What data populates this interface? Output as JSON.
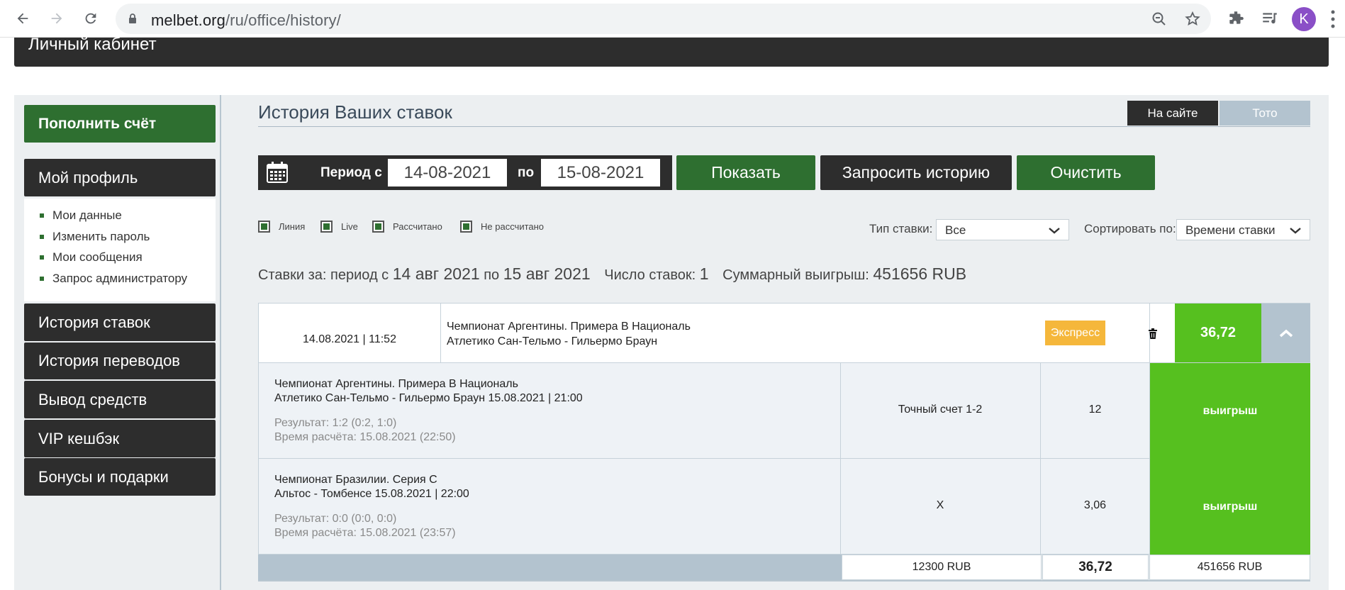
{
  "browser": {
    "url_host": "melbet.org",
    "url_path": "/ru/office/history/",
    "avatar_letter": "K",
    "accent_color": "#8a4fc7"
  },
  "header": {
    "title": "Личный кабинет"
  },
  "sidebar": {
    "deposit_label": "Пополнить счёт",
    "profile_label": "Мой профиль",
    "profile_links": [
      "Мои данные",
      "Изменить пароль",
      "Мои сообщения",
      "Запрос администратору"
    ],
    "items": [
      "История ставок",
      "История переводов",
      "Вывод средств",
      "VIP кешбэк",
      "Бонусы и подарки"
    ]
  },
  "main": {
    "title": "История Ваших ставок",
    "toggle_site": "На сайте",
    "toggle_toto": "Тото",
    "period_from_label": "Период с",
    "period_to_label": "по",
    "date_from": "14-08-2021",
    "date_to": "15-08-2021",
    "show_button": "Показать",
    "request_button": "Запросить историю",
    "clear_button": "Очистить",
    "filters": [
      "Линия",
      "Live",
      "Рассчитано",
      "Не рассчитано"
    ],
    "bet_type_label": "Тип ставки:",
    "bet_type_value": "Все",
    "sort_label": "Сортировать по:",
    "sort_value": "Времени ставки"
  },
  "summary": {
    "prefix": "Ставки за: период с ",
    "from": "14 авг 2021",
    "middle": " по ",
    "to": "15 авг 2021",
    "count_label": "Число ставок: ",
    "count": "1",
    "winnings_label": "Суммарный выигрыш: ",
    "winnings": "451656 RUB"
  },
  "bet": {
    "datetime": "14.08.2021 | 11:52",
    "championship": "Чемпионат Аргентины. Примера В Националь",
    "match": "Атлетико Сан-Тельмо - Гильермо Браун",
    "type_badge": "Экспресс",
    "coefficient": "36,72",
    "status_color": "#56c01f",
    "badge_color": "#f5b73b"
  },
  "details": [
    {
      "championship": "Чемпионат Аргентины. Примера В Националь",
      "match": "Атлетико Сан-Тельмо - Гильермо Браун 15.08.2021 | 21:00",
      "result": "Результат: 1:2 (0:2, 1:0)",
      "settle_time": "Время расчёта: 15.08.2021 (22:50)",
      "bet_type": "Точный счет 1-2",
      "coefficient": "12",
      "status": "выигрыш"
    },
    {
      "championship": "Чемпионат Бразилии. Серия С",
      "match": "Альтос - Томбенсе 15.08.2021 | 22:00",
      "result": "Результат: 0:0 (0:0, 0:0)",
      "settle_time": "Время расчёта: 15.08.2021 (23:57)",
      "bet_type": "X",
      "coefficient": "3,06",
      "status": "выигрыш"
    }
  ],
  "totals": {
    "stake": "12300 RUB",
    "coefficient": "36,72",
    "payout": "451656 RUB"
  }
}
